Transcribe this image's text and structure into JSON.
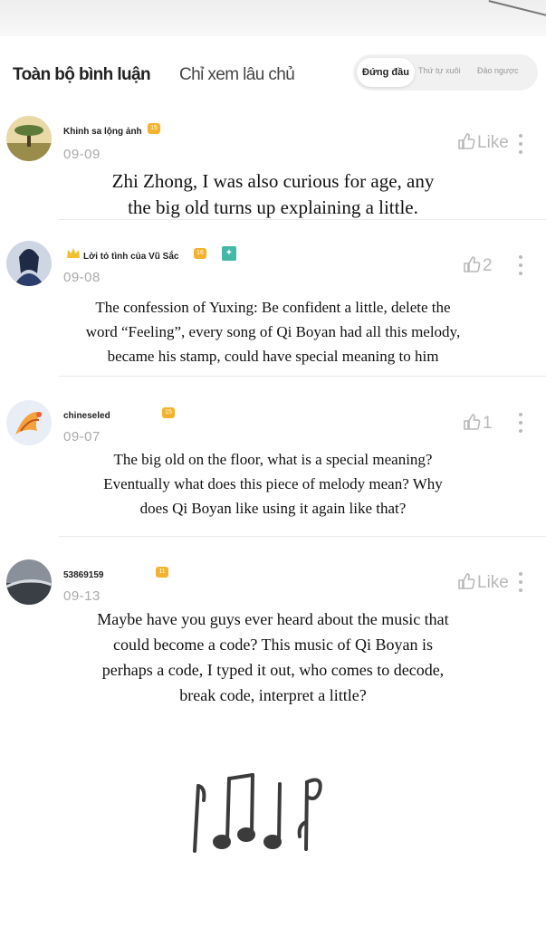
{
  "tabs": {
    "all_comments": "Toàn bộ bình luận",
    "owner_only": "Chỉ xem lâu chủ"
  },
  "sort": {
    "top": "Đứng đầu",
    "newest": "Thứ tự xuôi",
    "reverse": "Đảo ngược"
  },
  "comments": [
    {
      "username": "Khinh sa lộng ảnh",
      "level": "15",
      "date": "09-09",
      "like_label": "Like",
      "text": [
        "Zhi Zhong, I was also curious for age, any",
        "the big old turns up explaining a little."
      ]
    },
    {
      "username": "Lời tỏ tình của Vũ Sắc",
      "level": "16",
      "date": "09-08",
      "like_count": "2",
      "text": [
        "The confession of Yuxing: Be confident a little, delete the",
        "word “Feeling”, every song of Qi Boyan had all this melody,",
        "became his stamp, could have special meaning to him"
      ]
    },
    {
      "username": "chineseled",
      "level": "15",
      "date": "09-07",
      "like_count": "1",
      "text": [
        "The big old on the floor, what is a special meaning?",
        "Eventually what does this piece of melody mean? Why",
        "does Qi Boyan like using it again like that?"
      ]
    },
    {
      "username": "53869159",
      "level": "11",
      "date": "09-13",
      "like_label": "Like",
      "text": [
        "Maybe have you guys ever heard about the music that",
        "could become a code? This music of Qi Boyan is",
        "perhaps a code, I typed it out, who comes to decode,",
        "break code, interpret a little?"
      ]
    }
  ],
  "colors": {
    "badge": "#f4b32c",
    "gem": "#43b8a6",
    "like_grey": "#b9b9b9",
    "date_grey": "#aaaaaa"
  },
  "icons": [
    "thumbs-up-icon",
    "more-vertical-icon",
    "level-badge-icon",
    "crown-icon",
    "music-notes-icon"
  ]
}
